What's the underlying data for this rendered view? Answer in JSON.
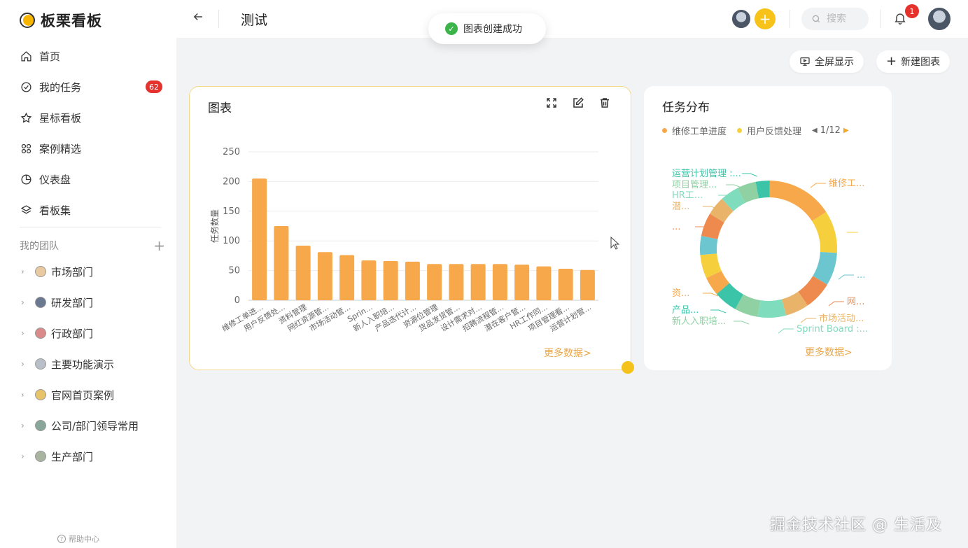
{
  "app": {
    "name": "板栗看板"
  },
  "nav": [
    {
      "label": "首页",
      "icon": "home-icon"
    },
    {
      "label": "我的任务",
      "icon": "check-circle-icon",
      "badge": "62"
    },
    {
      "label": "星标看板",
      "icon": "star-icon"
    },
    {
      "label": "案例精选",
      "icon": "grid-icon"
    },
    {
      "label": "仪表盘",
      "icon": "pie-icon"
    },
    {
      "label": "看板集",
      "icon": "layers-icon"
    }
  ],
  "team_section": {
    "label": "我的团队"
  },
  "teams": [
    {
      "label": "市场部门"
    },
    {
      "label": "研发部门"
    },
    {
      "label": "行政部门"
    },
    {
      "label": "主要功能演示"
    },
    {
      "label": "官网首页案例"
    },
    {
      "label": "公司/部门领导常用"
    },
    {
      "label": "生产部门"
    }
  ],
  "help": {
    "label": "帮助中心"
  },
  "header": {
    "title": "测试",
    "search_placeholder": "搜索",
    "notification_count": "1"
  },
  "toast": {
    "text": "图表创建成功"
  },
  "toolbar": {
    "fullscreen": "全屏显示",
    "new_chart": "新建图表"
  },
  "colors": {
    "accent": "#f7a84a",
    "brand_yellow": "#f5c21c",
    "badge_red": "#e5322d"
  },
  "bar_card": {
    "title": "图表",
    "more": "更多数据>"
  },
  "donut_card": {
    "title": "任务分布",
    "legend": [
      {
        "label": "维修工单进度",
        "color": "#f7a84a"
      },
      {
        "label": "用户反馈处理",
        "color": "#f5d03c"
      }
    ],
    "pager": "1/12",
    "more": "更多数据>",
    "labels_left": [
      "运营计划管理 :...",
      "项目管理...",
      "HR工...",
      "潜...",
      "...",
      "资...",
      "产品...",
      "新人入职培..."
    ],
    "labels_right": [
      "维修工...",
      "...",
      "网...",
      "市场活动...",
      "Sprint Board :..."
    ]
  },
  "chart_data": [
    {
      "type": "bar",
      "title": "",
      "xlabel": "",
      "ylabel": "任务数量",
      "ylim": [
        0,
        250
      ],
      "yticks": [
        0,
        50,
        100,
        150,
        200,
        250
      ],
      "grid": true,
      "color": "#f7a84a",
      "categories": [
        "维修工单进...",
        "用户反馈处...",
        "资料管理",
        "网红资源管...",
        "市场活动管...",
        "Sprin...",
        "新人入职培...",
        "产品迭代计...",
        "资源位管理",
        "货品发货管...",
        "设计需求对...",
        "招聘流程管...",
        "潜在客户管...",
        "HR工作同...",
        "项目管理看...",
        "运营计划管..."
      ],
      "values": [
        205,
        125,
        92,
        81,
        76,
        67,
        66,
        65,
        61,
        61,
        61,
        61,
        60,
        57,
        53,
        51
      ]
    },
    {
      "type": "pie",
      "title": "任务分布",
      "donut": true,
      "series": [
        {
          "name": "维修工单进度",
          "value": 14,
          "color": "#f7a84a"
        },
        {
          "name": "用户反馈处理",
          "value": 9,
          "color": "#f5d03c"
        },
        {
          "name": "",
          "value": 7,
          "color": "#6cc6cf"
        },
        {
          "name": "",
          "value": 6,
          "color": "#ef8a4f"
        },
        {
          "name": "市场活动",
          "value": 5,
          "color": "#e9b46a"
        },
        {
          "name": "Sprint Board",
          "value": 6,
          "color": "#7fdcbd"
        },
        {
          "name": "新人入职培训",
          "value": 5,
          "color": "#8fd1a3"
        },
        {
          "name": "产品",
          "value": 5,
          "color": "#3bc4a8"
        },
        {
          "name": "资",
          "value": 4,
          "color": "#f7a84a"
        },
        {
          "name": "",
          "value": 5,
          "color": "#f5d03c"
        },
        {
          "name": "",
          "value": 4,
          "color": "#6cc6cf"
        },
        {
          "name": "",
          "value": 5,
          "color": "#ef8a4f"
        },
        {
          "name": "潜",
          "value": 4,
          "color": "#e9b46a"
        },
        {
          "name": "HR工作",
          "value": 4,
          "color": "#7fdcbd"
        },
        {
          "name": "项目管理",
          "value": 4,
          "color": "#8fd1a3"
        },
        {
          "name": "运营计划管理",
          "value": 3,
          "color": "#3bc4a8"
        }
      ]
    }
  ]
}
